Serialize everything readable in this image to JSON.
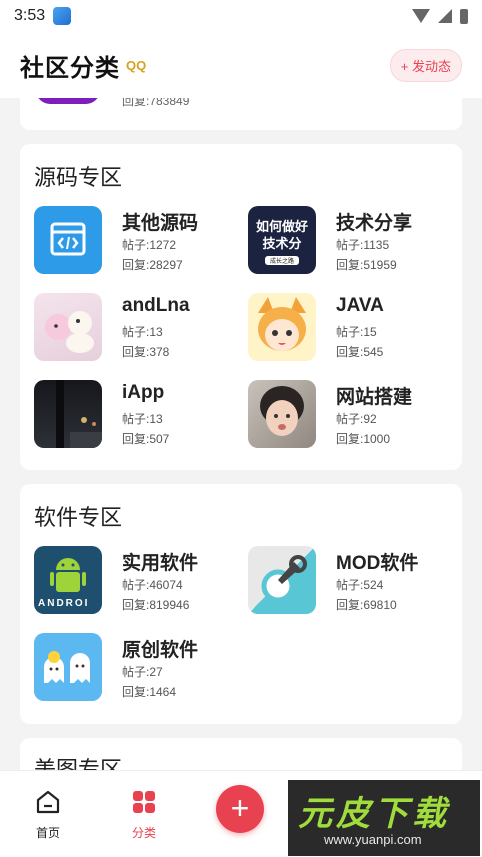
{
  "statusbar": {
    "time": "3:53"
  },
  "header": {
    "title": "社区分类",
    "title_badge": "QQ",
    "post_button": "+ 发动态"
  },
  "partial_card": {
    "reply_text": "回复:783849"
  },
  "sections": [
    {
      "title": "源码专区",
      "items": [
        {
          "name": "其他源码",
          "posts": "帖子:1272",
          "replies": "回复:28297",
          "thumb": "code-window"
        },
        {
          "name": "技术分享",
          "posts": "帖子:1135",
          "replies": "回复:51959",
          "thumb_text": "如何做好\n技术分",
          "thumb_sub": "成长之路"
        },
        {
          "name": "andLna",
          "posts": "帖子:13",
          "replies": "回复:378",
          "thumb": "plush"
        },
        {
          "name": "JAVA",
          "posts": "帖子:15",
          "replies": "回复:545",
          "thumb": "fox-girl"
        },
        {
          "name": "iApp",
          "posts": "帖子:13",
          "replies": "回复:507",
          "thumb": "night"
        },
        {
          "name": "网站搭建",
          "posts": "帖子:92",
          "replies": "回复:1000",
          "thumb": "selfie"
        }
      ]
    },
    {
      "title": "软件专区",
      "items": [
        {
          "name": "实用软件",
          "posts": "帖子:46074",
          "replies": "回复:819946",
          "thumb_text": "ANDROI",
          "thumb": "android"
        },
        {
          "name": "MOD软件",
          "posts": "帖子:524",
          "replies": "回复:69810",
          "thumb": "wrench"
        },
        {
          "name": "原创软件",
          "posts": "帖子:27",
          "replies": "回复:1464",
          "thumb": "ghosts"
        }
      ]
    },
    {
      "title": "美图专区"
    }
  ],
  "tabbar": {
    "home_label": "首页",
    "category_label": "分类",
    "fab_label": "+"
  },
  "watermark": {
    "title": "元皮下载",
    "url": "www.yuanpi.com"
  },
  "colors": {
    "accent": "#e84150",
    "background": "#f3f3f3"
  }
}
